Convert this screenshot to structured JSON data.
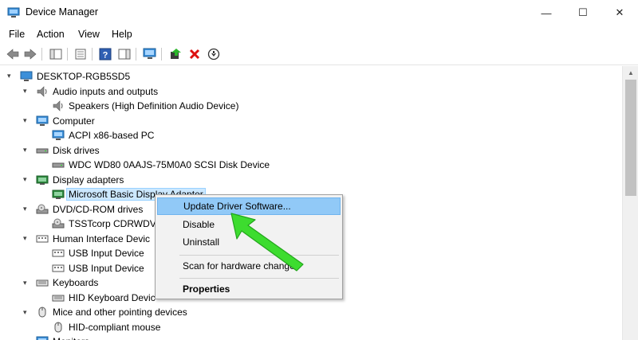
{
  "window": {
    "title": "Device Manager",
    "minimize": "—",
    "maximize": "☐",
    "close": "✕"
  },
  "menu": [
    "File",
    "Action",
    "View",
    "Help"
  ],
  "tree": {
    "root": "DESKTOP-RGB5SD5",
    "nodes": [
      {
        "label": "Audio inputs and outputs",
        "level": 1,
        "icon": "speaker-icon",
        "expanded": true
      },
      {
        "label": "Speakers (High Definition Audio Device)",
        "level": 2,
        "icon": "speaker-icon"
      },
      {
        "label": "Computer",
        "level": 1,
        "icon": "monitor-icon",
        "expanded": true
      },
      {
        "label": "ACPI x86-based PC",
        "level": 2,
        "icon": "monitor-icon"
      },
      {
        "label": "Disk drives",
        "level": 1,
        "icon": "disk-drive-icon",
        "expanded": true
      },
      {
        "label": "WDC WD80 0AAJS-75M0A0 SCSI Disk Device",
        "level": 2,
        "icon": "disk-drive-icon"
      },
      {
        "label": "Display adapters",
        "level": 1,
        "icon": "display-adapter-icon",
        "expanded": true
      },
      {
        "label": "Microsoft Basic Display Adapter",
        "level": 2,
        "icon": "display-adapter-icon",
        "selected": true
      },
      {
        "label": "DVD/CD-ROM drives",
        "level": 1,
        "icon": "dvd-drive-icon",
        "expanded": true
      },
      {
        "label": "TSSTcorp CDRWDVI",
        "level": 2,
        "icon": "dvd-drive-icon"
      },
      {
        "label": "Human Interface Devic",
        "level": 1,
        "icon": "hid-icon",
        "expanded": true
      },
      {
        "label": "USB Input Device",
        "level": 2,
        "icon": "hid-icon"
      },
      {
        "label": "USB Input Device",
        "level": 2,
        "icon": "hid-icon"
      },
      {
        "label": "Keyboards",
        "level": 1,
        "icon": "keyboard-icon",
        "expanded": true
      },
      {
        "label": "HID Keyboard Devic",
        "level": 2,
        "icon": "keyboard-icon"
      },
      {
        "label": "Mice and other pointing devices",
        "level": 1,
        "icon": "mouse-icon",
        "expanded": true
      },
      {
        "label": "HID-compliant mouse",
        "level": 2,
        "icon": "mouse-icon"
      },
      {
        "label": "Monitors",
        "level": 1,
        "icon": "monitor-icon",
        "expanded": true
      }
    ]
  },
  "context_menu": {
    "update": "Update Driver Software...",
    "disable": "Disable",
    "uninstall": "Uninstall",
    "scan": "Scan for hardware changes",
    "properties": "Properties"
  },
  "colors": {
    "selection": "#cce8ff",
    "menu_highlight": "#91c9f7",
    "pointer_arrow": "#3ddc2f"
  }
}
